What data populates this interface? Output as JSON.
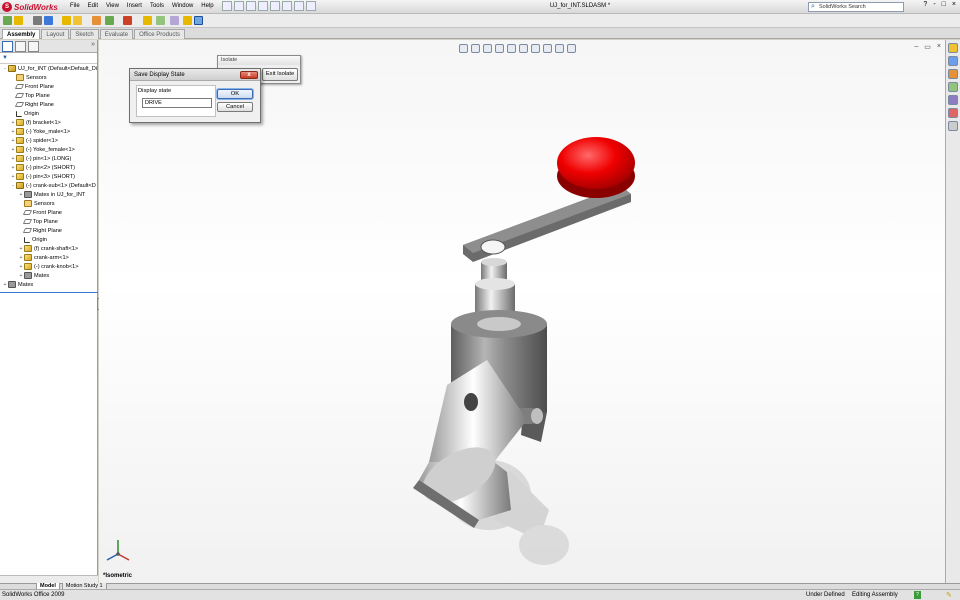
{
  "app": {
    "brand": "SolidWorks",
    "document_title": "UJ_for_INT.SLDASM *",
    "window_buttons": [
      "?",
      "-",
      "□",
      "×"
    ]
  },
  "menu": [
    "File",
    "Edit",
    "View",
    "Insert",
    "Tools",
    "Window",
    "Help"
  ],
  "search": {
    "placeholder": "SolidWorks Search"
  },
  "command_tabs": [
    "Assembly",
    "Layout",
    "Sketch",
    "Evaluate",
    "Office Products"
  ],
  "feature_tree": {
    "filter_icon": "funnel-icon",
    "items": [
      {
        "label": "UJ_for_INT  (Default<Default_Di",
        "icon": "assembly",
        "level": 0,
        "expander": "-"
      },
      {
        "label": "Sensors",
        "icon": "sensor",
        "level": 1,
        "expander": ""
      },
      {
        "label": "Front Plane",
        "icon": "plane",
        "level": 1,
        "expander": ""
      },
      {
        "label": "Top Plane",
        "icon": "plane",
        "level": 1,
        "expander": ""
      },
      {
        "label": "Right Plane",
        "icon": "plane",
        "level": 1,
        "expander": ""
      },
      {
        "label": "Origin",
        "icon": "origin",
        "level": 1,
        "expander": ""
      },
      {
        "label": "(f) bracket<1>",
        "icon": "part",
        "level": 1,
        "expander": "+"
      },
      {
        "label": "(-) Yoke_male<1>",
        "icon": "part",
        "level": 1,
        "expander": "+"
      },
      {
        "label": "(-) spider<1>",
        "icon": "part",
        "level": 1,
        "expander": "+"
      },
      {
        "label": "(-) Yoke_female<1>",
        "icon": "part",
        "level": 1,
        "expander": "+"
      },
      {
        "label": "(-) pin<1> (LONG)",
        "icon": "part",
        "level": 1,
        "expander": "+"
      },
      {
        "label": "(-) pin<2> (SHORT)",
        "icon": "part",
        "level": 1,
        "expander": "+"
      },
      {
        "label": "(-) pin<3> (SHORT)",
        "icon": "part",
        "level": 1,
        "expander": "+"
      },
      {
        "label": "(-) crank-sub<1> (Default<D",
        "icon": "assembly",
        "level": 1,
        "expander": "-"
      },
      {
        "label": "Mates in UJ_for_INT",
        "icon": "mates",
        "level": 2,
        "expander": "+"
      },
      {
        "label": "Sensors",
        "icon": "sensor",
        "level": 2,
        "expander": ""
      },
      {
        "label": "Front Plane",
        "icon": "plane",
        "level": 2,
        "expander": ""
      },
      {
        "label": "Top Plane",
        "icon": "plane",
        "level": 2,
        "expander": ""
      },
      {
        "label": "Right Plane",
        "icon": "plane",
        "level": 2,
        "expander": ""
      },
      {
        "label": "Origin",
        "icon": "origin",
        "level": 2,
        "expander": ""
      },
      {
        "label": "(f) crank-shaft<1>",
        "icon": "part",
        "level": 2,
        "expander": "+"
      },
      {
        "label": "crank-arm<1>",
        "icon": "part",
        "level": 2,
        "expander": "+"
      },
      {
        "label": "(-) crank-knob<1>",
        "icon": "part",
        "level": 2,
        "expander": "+"
      },
      {
        "label": "Mates",
        "icon": "mates",
        "level": 2,
        "expander": "+"
      },
      {
        "label": "Mates",
        "icon": "mates",
        "level": 0,
        "expander": "+"
      }
    ]
  },
  "viewport": {
    "view_label": "*Isometric",
    "knob_color": "#e00000",
    "metal_color": "#8c8c8c"
  },
  "isolate_popup": {
    "title": "Isolate",
    "exit_label": "Exit Isolate"
  },
  "save_dialog": {
    "title": "Save Display State",
    "close_label": "x",
    "field_label": "Display state",
    "field_value": "DRIVE",
    "ok_label": "OK",
    "cancel_label": "Cancel"
  },
  "bottom_tabs": [
    "Model",
    "Motion Study 1"
  ],
  "status": {
    "product": "SolidWorks Office 2009",
    "defined": "Under Defined",
    "mode": "Editing Assembly",
    "help": "?"
  }
}
